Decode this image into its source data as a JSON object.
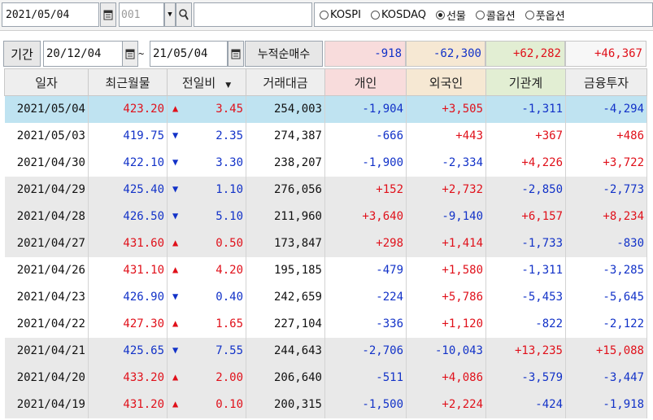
{
  "toolbar": {
    "date": "2021/05/04",
    "code_placeholder": "001",
    "radios": [
      {
        "label": "KOSPI",
        "selected": false
      },
      {
        "label": "KOSDAQ",
        "selected": false
      },
      {
        "label": "선물",
        "selected": true
      },
      {
        "label": "콜옵션",
        "selected": false
      },
      {
        "label": "풋옵션",
        "selected": false
      }
    ]
  },
  "filter": {
    "label": "기간",
    "from": "20/12/04",
    "tilde": "~",
    "to": "21/05/04",
    "cum_label": "누적순매수",
    "cum_individual": "-918",
    "cum_foreign": "-62,300",
    "cum_institution": "+62,282",
    "cum_financial": "+46,367"
  },
  "table": {
    "headers": [
      "일자",
      "최근월물",
      "전일비",
      "거래대금",
      "개인",
      "외국인",
      "기관계",
      "금융투자"
    ],
    "rows": [
      {
        "date": "2021/05/04",
        "price": "423.20",
        "dir": "up",
        "chg": "3.45",
        "volume": "254,003",
        "ind": "-1,904",
        "frn": "+3,505",
        "ins": "-1,311",
        "fin": "-4,294",
        "style": "sel"
      },
      {
        "date": "2021/05/03",
        "price": "419.75",
        "dir": "down",
        "chg": "2.35",
        "volume": "274,387",
        "ind": "-666",
        "frn": "+443",
        "ins": "+367",
        "fin": "+486",
        "style": ""
      },
      {
        "date": "2021/04/30",
        "price": "422.10",
        "dir": "down",
        "chg": "3.30",
        "volume": "238,207",
        "ind": "-1,900",
        "frn": "-2,334",
        "ins": "+4,226",
        "fin": "+3,722",
        "style": ""
      },
      {
        "date": "2021/04/29",
        "price": "425.40",
        "dir": "down",
        "chg": "1.10",
        "volume": "276,056",
        "ind": "+152",
        "frn": "+2,732",
        "ins": "-2,850",
        "fin": "-2,773",
        "style": "gray"
      },
      {
        "date": "2021/04/28",
        "price": "426.50",
        "dir": "down",
        "chg": "5.10",
        "volume": "211,960",
        "ind": "+3,640",
        "frn": "-9,140",
        "ins": "+6,157",
        "fin": "+8,234",
        "style": "gray"
      },
      {
        "date": "2021/04/27",
        "price": "431.60",
        "dir": "up",
        "chg": "0.50",
        "volume": "173,847",
        "ind": "+298",
        "frn": "+1,414",
        "ins": "-1,733",
        "fin": "-830",
        "style": "gray"
      },
      {
        "date": "2021/04/26",
        "price": "431.10",
        "dir": "up",
        "chg": "4.20",
        "volume": "195,185",
        "ind": "-479",
        "frn": "+1,580",
        "ins": "-1,311",
        "fin": "-3,285",
        "style": ""
      },
      {
        "date": "2021/04/23",
        "price": "426.90",
        "dir": "down",
        "chg": "0.40",
        "volume": "242,659",
        "ind": "-224",
        "frn": "+5,786",
        "ins": "-5,453",
        "fin": "-5,645",
        "style": ""
      },
      {
        "date": "2021/04/22",
        "price": "427.30",
        "dir": "up",
        "chg": "1.65",
        "volume": "227,104",
        "ind": "-336",
        "frn": "+1,120",
        "ins": "-822",
        "fin": "-2,122",
        "style": ""
      },
      {
        "date": "2021/04/21",
        "price": "425.65",
        "dir": "down",
        "chg": "7.55",
        "volume": "244,643",
        "ind": "-2,706",
        "frn": "-10,043",
        "ins": "+13,235",
        "fin": "+15,088",
        "style": "gray"
      },
      {
        "date": "2021/04/20",
        "price": "433.20",
        "dir": "up",
        "chg": "2.00",
        "volume": "206,640",
        "ind": "-511",
        "frn": "+4,086",
        "ins": "-3,579",
        "fin": "-3,447",
        "style": "gray"
      },
      {
        "date": "2021/04/19",
        "price": "431.20",
        "dir": "up",
        "chg": "0.10",
        "volume": "200,315",
        "ind": "-1,500",
        "frn": "+2,224",
        "ins": "-424",
        "fin": "-1,918",
        "style": "gray"
      }
    ]
  },
  "colors": {
    "up": "#e0101a",
    "down": "#1232c8",
    "selected": "#bfe3f1"
  }
}
